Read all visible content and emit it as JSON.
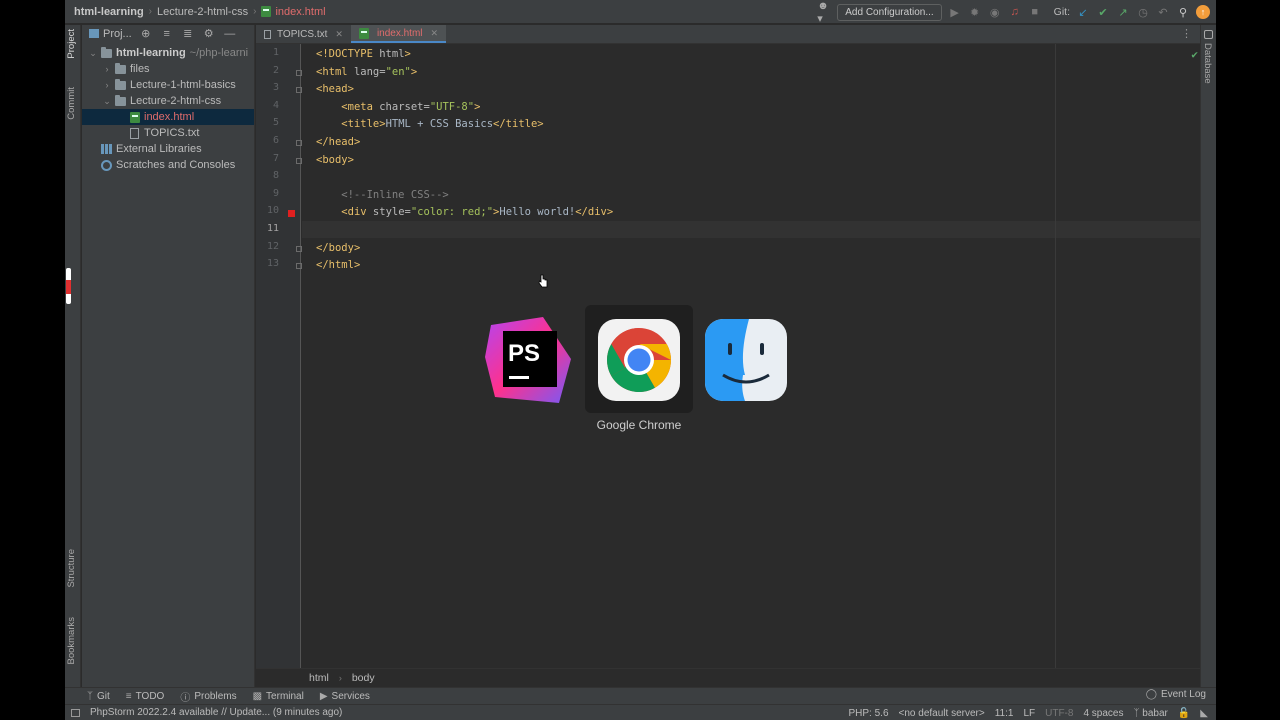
{
  "titlebar": {
    "crumbs": [
      "html-learning",
      "Lecture-2-html-css",
      "index.html"
    ],
    "add_configuration": "Add Configuration...",
    "git_label": "Git:"
  },
  "left_strip": {
    "project": "Project",
    "commit": "Commit",
    "structure": "Structure",
    "bookmarks": "Bookmarks"
  },
  "right_strip": {
    "database": "Database"
  },
  "project_panel": {
    "header": "Proj...",
    "tree": [
      {
        "label": "html-learning",
        "suffix": "~/php-learni",
        "kind": "folder",
        "indent": 0,
        "expanded": true
      },
      {
        "label": "files",
        "kind": "folder",
        "indent": 1,
        "expanded": false
      },
      {
        "label": "Lecture-1-html-basics",
        "kind": "folder",
        "indent": 1,
        "expanded": false
      },
      {
        "label": "Lecture-2-html-css",
        "kind": "folder",
        "indent": 1,
        "expanded": true
      },
      {
        "label": "index.html",
        "kind": "html",
        "indent": 2,
        "selected": true
      },
      {
        "label": "TOPICS.txt",
        "kind": "txt",
        "indent": 2
      },
      {
        "label": "External Libraries",
        "kind": "lib",
        "indent": 0
      },
      {
        "label": "Scratches and Consoles",
        "kind": "scratch",
        "indent": 0
      }
    ]
  },
  "tabs": [
    {
      "label": "TOPICS.txt",
      "active": false
    },
    {
      "label": "index.html",
      "active": true
    }
  ],
  "editor": {
    "line_numbers": [
      "1",
      "2",
      "3",
      "4",
      "5",
      "6",
      "7",
      "8",
      "9",
      "10",
      "11",
      "12",
      "13"
    ],
    "current_line": "11",
    "lines": [
      "<!DOCTYPE html>",
      "<html lang=\"en\">",
      "<head>",
      "    <meta charset=\"UTF-8\">",
      "    <title>HTML + CSS Basics</title>",
      "</head>",
      "<body>",
      "",
      "    <!--Inline CSS-->",
      "    <div style=\"color: red;\">Hello world!</div>",
      "",
      "</body>",
      "</html>"
    ]
  },
  "app_switcher": {
    "apps": [
      "PhpStorm",
      "Google Chrome",
      "Finder"
    ],
    "selected_label": "Google Chrome"
  },
  "navbar": {
    "items": [
      "html",
      "body"
    ]
  },
  "toolwindows": {
    "git": "Git",
    "todo": "TODO",
    "problems": "Problems",
    "terminal": "Terminal",
    "services": "Services",
    "event_log": "Event Log"
  },
  "statusbar": {
    "message": "PhpStorm 2022.2.4 available // Update... (9 minutes ago)",
    "php": "PHP: 5.6",
    "server": "<no default server>",
    "position": "11:1",
    "line_sep": "LF",
    "encoding": "UTF-8",
    "indent": "4 spaces",
    "branch": "babar"
  },
  "colors": {
    "accent": "#4a88c7",
    "html_file": "#e06c6c",
    "tag": "#e8bf6a",
    "string": "#a5c25c",
    "comment": "#808080"
  }
}
